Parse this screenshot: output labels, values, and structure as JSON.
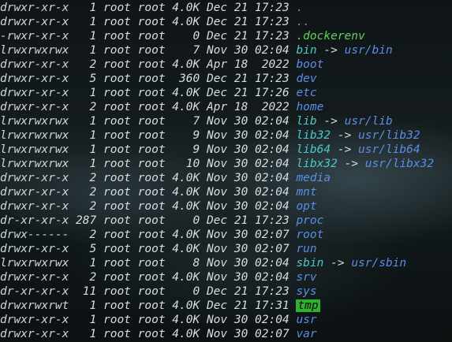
{
  "terminal": {
    "entries": [
      {
        "perms": "drwxr-xr-x",
        "links": "  1",
        "owner": "root",
        "group": "root",
        "size": "4.0K",
        "date": "Dec 21 17:23",
        "name": ".",
        "kind": "dir",
        "target": ""
      },
      {
        "perms": "drwxr-xr-x",
        "links": "  1",
        "owner": "root",
        "group": "root",
        "size": "4.0K",
        "date": "Dec 21 17:23",
        "name": "..",
        "kind": "dir",
        "target": ""
      },
      {
        "perms": "-rwxr-xr-x",
        "links": "  1",
        "owner": "root",
        "group": "root",
        "size": "   0",
        "date": "Dec 21 17:23",
        "name": ".dockerenv",
        "kind": "exec",
        "target": ""
      },
      {
        "perms": "lrwxrwxrwx",
        "links": "  1",
        "owner": "root",
        "group": "root",
        "size": "   7",
        "date": "Nov 30 02:04",
        "name": "bin",
        "kind": "link",
        "target": "usr/bin"
      },
      {
        "perms": "drwxr-xr-x",
        "links": "  2",
        "owner": "root",
        "group": "root",
        "size": "4.0K",
        "date": "Apr 18  2022",
        "name": "boot",
        "kind": "dir",
        "target": ""
      },
      {
        "perms": "drwxr-xr-x",
        "links": "  5",
        "owner": "root",
        "group": "root",
        "size": " 360",
        "date": "Dec 21 17:23",
        "name": "dev",
        "kind": "dir",
        "target": ""
      },
      {
        "perms": "drwxr-xr-x",
        "links": "  1",
        "owner": "root",
        "group": "root",
        "size": "4.0K",
        "date": "Dec 21 17:26",
        "name": "etc",
        "kind": "dir",
        "target": ""
      },
      {
        "perms": "drwxr-xr-x",
        "links": "  2",
        "owner": "root",
        "group": "root",
        "size": "4.0K",
        "date": "Apr 18  2022",
        "name": "home",
        "kind": "dir",
        "target": ""
      },
      {
        "perms": "lrwxrwxrwx",
        "links": "  1",
        "owner": "root",
        "group": "root",
        "size": "   7",
        "date": "Nov 30 02:04",
        "name": "lib",
        "kind": "link",
        "target": "usr/lib"
      },
      {
        "perms": "lrwxrwxrwx",
        "links": "  1",
        "owner": "root",
        "group": "root",
        "size": "   9",
        "date": "Nov 30 02:04",
        "name": "lib32",
        "kind": "link",
        "target": "usr/lib32"
      },
      {
        "perms": "lrwxrwxrwx",
        "links": "  1",
        "owner": "root",
        "group": "root",
        "size": "   9",
        "date": "Nov 30 02:04",
        "name": "lib64",
        "kind": "link",
        "target": "usr/lib64"
      },
      {
        "perms": "lrwxrwxrwx",
        "links": "  1",
        "owner": "root",
        "group": "root",
        "size": "  10",
        "date": "Nov 30 02:04",
        "name": "libx32",
        "kind": "link",
        "target": "usr/libx32"
      },
      {
        "perms": "drwxr-xr-x",
        "links": "  2",
        "owner": "root",
        "group": "root",
        "size": "4.0K",
        "date": "Nov 30 02:04",
        "name": "media",
        "kind": "dir",
        "target": ""
      },
      {
        "perms": "drwxr-xr-x",
        "links": "  2",
        "owner": "root",
        "group": "root",
        "size": "4.0K",
        "date": "Nov 30 02:04",
        "name": "mnt",
        "kind": "dir",
        "target": ""
      },
      {
        "perms": "drwxr-xr-x",
        "links": "  2",
        "owner": "root",
        "group": "root",
        "size": "4.0K",
        "date": "Nov 30 02:04",
        "name": "opt",
        "kind": "dir",
        "target": ""
      },
      {
        "perms": "dr-xr-xr-x",
        "links": "287",
        "owner": "root",
        "group": "root",
        "size": "   0",
        "date": "Dec 21 17:23",
        "name": "proc",
        "kind": "dir",
        "target": ""
      },
      {
        "perms": "drwx------",
        "links": "  2",
        "owner": "root",
        "group": "root",
        "size": "4.0K",
        "date": "Nov 30 02:07",
        "name": "root",
        "kind": "dir",
        "target": ""
      },
      {
        "perms": "drwxr-xr-x",
        "links": "  5",
        "owner": "root",
        "group": "root",
        "size": "4.0K",
        "date": "Nov 30 02:07",
        "name": "run",
        "kind": "dir",
        "target": ""
      },
      {
        "perms": "lrwxrwxrwx",
        "links": "  1",
        "owner": "root",
        "group": "root",
        "size": "   8",
        "date": "Nov 30 02:04",
        "name": "sbin",
        "kind": "link",
        "target": "usr/sbin"
      },
      {
        "perms": "drwxr-xr-x",
        "links": "  2",
        "owner": "root",
        "group": "root",
        "size": "4.0K",
        "date": "Nov 30 02:04",
        "name": "srv",
        "kind": "dir",
        "target": ""
      },
      {
        "perms": "dr-xr-xr-x",
        "links": " 11",
        "owner": "root",
        "group": "root",
        "size": "   0",
        "date": "Dec 21 17:23",
        "name": "sys",
        "kind": "dir",
        "target": ""
      },
      {
        "perms": "drwxrwxrwt",
        "links": "  1",
        "owner": "root",
        "group": "root",
        "size": "4.0K",
        "date": "Dec 21 17:31",
        "name": "tmp",
        "kind": "sticky",
        "target": ""
      },
      {
        "perms": "drwxr-xr-x",
        "links": "  1",
        "owner": "root",
        "group": "root",
        "size": "4.0K",
        "date": "Nov 30 02:04",
        "name": "usr",
        "kind": "dir",
        "target": ""
      },
      {
        "perms": "drwxr-xr-x",
        "links": "  1",
        "owner": "root",
        "group": "root",
        "size": "4.0K",
        "date": "Nov 30 02:07",
        "name": "var",
        "kind": "dir",
        "target": ""
      }
    ],
    "arrow": "->",
    "colors": {
      "directory": "#5b8ee6",
      "executable": "#5fd35a",
      "symlink": "#4ec9c9",
      "sticky_bg": "#2fb12f",
      "text": "#d8dde0"
    }
  }
}
